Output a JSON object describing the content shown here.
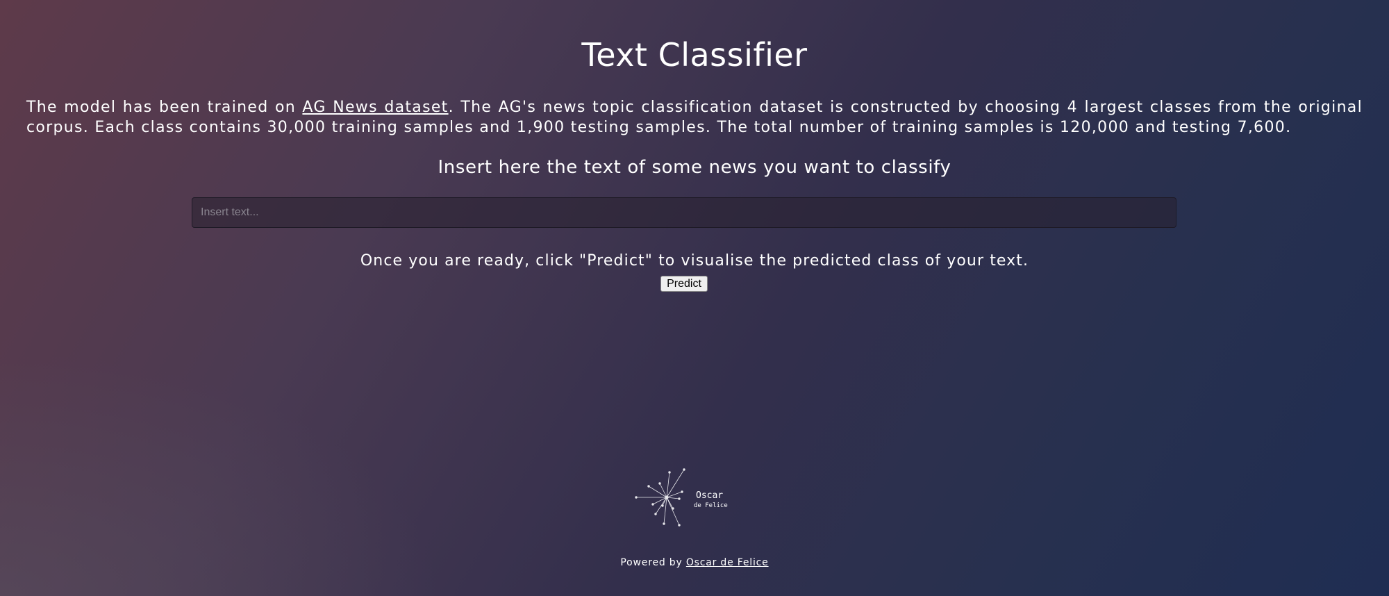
{
  "header": {
    "title": "Text Classifier"
  },
  "description": {
    "prefix": "The model has been trained on ",
    "link_text": "AG News dataset",
    "suffix": ". The AG's news topic classification dataset is constructed by choosing 4 largest classes from the original corpus. Each class contains 30,000 training samples and 1,900 testing samples. The total number of training samples is 120,000 and testing 7,600."
  },
  "form": {
    "prompt": "Insert here the text of some news you want to classify",
    "input_value": "",
    "input_placeholder": "Insert text...",
    "instructions": "Once you are ready, click \"Predict\" to visualise the predicted class of your text.",
    "predict_label": "Predict"
  },
  "logo": {
    "line1": "Oscar",
    "line2": "de Felice",
    "icon": "starburst-icon"
  },
  "footer": {
    "powered_by": "Powered by ",
    "author_link": "Oscar de Felice"
  }
}
